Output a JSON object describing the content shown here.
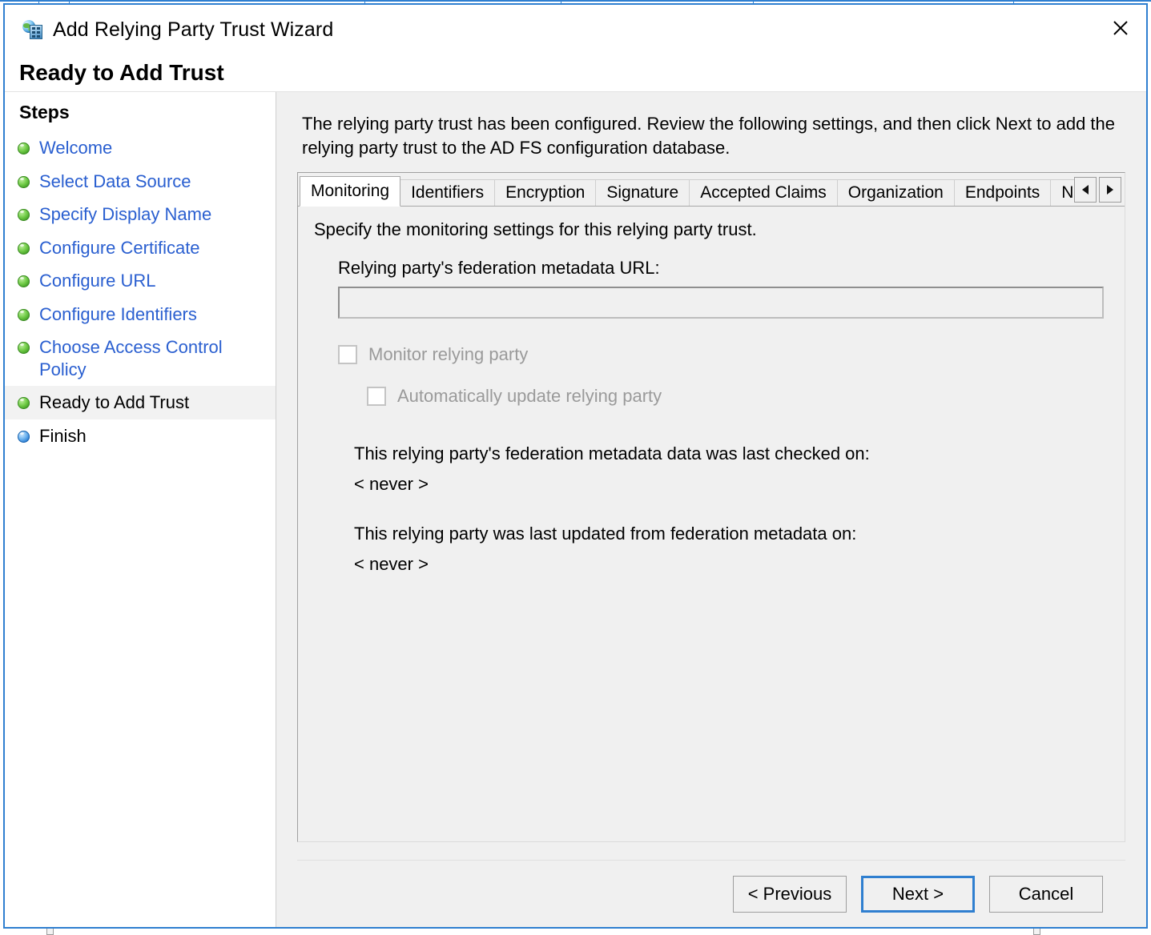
{
  "window": {
    "title": "Add Relying Party Trust Wizard",
    "icon": "globe-server-icon",
    "close_icon": "close-icon",
    "heading": "Ready to Add Trust",
    "accent_color": "#2f7fd0",
    "background_color": "#f0f0f0"
  },
  "sidebar": {
    "title": "Steps",
    "link_color": "#2a5fd0",
    "done_bullet_color": "#74cd4a",
    "active_bullet_color": "#6fb4ef",
    "items": [
      {
        "label": "Welcome",
        "state": "done"
      },
      {
        "label": "Select Data Source",
        "state": "done"
      },
      {
        "label": "Specify Display Name",
        "state": "done"
      },
      {
        "label": "Configure Certificate",
        "state": "done"
      },
      {
        "label": "Configure URL",
        "state": "done"
      },
      {
        "label": "Configure Identifiers",
        "state": "done"
      },
      {
        "label": "Choose Access Control Policy",
        "state": "done"
      },
      {
        "label": "Ready to Add Trust",
        "state": "current"
      },
      {
        "label": "Finish",
        "state": "pending"
      }
    ]
  },
  "main": {
    "intro": "The relying party trust has been configured. Review the following settings, and then click Next to add the relying party trust to the AD FS configuration database.",
    "tabs": [
      {
        "label": "Monitoring",
        "selected": true
      },
      {
        "label": "Identifiers",
        "selected": false
      },
      {
        "label": "Encryption",
        "selected": false
      },
      {
        "label": "Signature",
        "selected": false
      },
      {
        "label": "Accepted Claims",
        "selected": false
      },
      {
        "label": "Organization",
        "selected": false
      },
      {
        "label": "Endpoints",
        "selected": false
      },
      {
        "label": "Notes",
        "selected": false,
        "clipped": true
      }
    ],
    "tab_scroll": {
      "left_icon": "chevron-left-icon",
      "right_icon": "chevron-right-icon"
    },
    "monitoring": {
      "title": "Specify the monitoring settings for this relying party trust.",
      "url_label": "Relying party's federation metadata URL:",
      "url_value": "",
      "url_placeholder": "",
      "monitor_checkbox": {
        "label": "Monitor relying party",
        "checked": false,
        "disabled": true
      },
      "auto_update_checkbox": {
        "label": "Automatically update relying party",
        "checked": false,
        "disabled": true
      },
      "last_checked_label": "This relying party's federation metadata data was last checked on:",
      "last_checked_value": "< never >",
      "last_updated_label": "This relying party was last updated from federation metadata on:",
      "last_updated_value": "< never >"
    }
  },
  "footer": {
    "previous_label": "< Previous",
    "next_label": "Next >",
    "cancel_label": "Cancel"
  }
}
